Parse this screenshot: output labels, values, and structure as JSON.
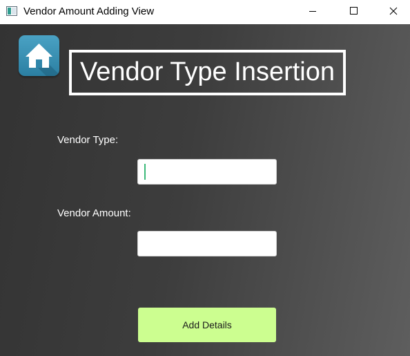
{
  "window": {
    "title": "Vendor Amount Adding View",
    "icon": "app-window-icon",
    "controls": {
      "minimize_icon": "minimize-icon",
      "maximize_icon": "maximize-icon",
      "close_icon": "close-icon"
    }
  },
  "header": {
    "home_icon": "home-icon",
    "home_button_color": "#3a94b9",
    "title": "Vendor Type Insertion"
  },
  "form": {
    "vendor_type": {
      "label": "Vendor Type:",
      "value": "",
      "placeholder": "",
      "focused": true,
      "caret_color": "#3cb97a"
    },
    "vendor_amount": {
      "label": "Vendor Amount:",
      "value": "",
      "placeholder": ""
    },
    "submit": {
      "label": "Add Details",
      "color": "#ccfe90"
    }
  },
  "colors": {
    "background_dark": "#333333",
    "background_light": "#5e5e5e",
    "text": "#ffffff"
  }
}
